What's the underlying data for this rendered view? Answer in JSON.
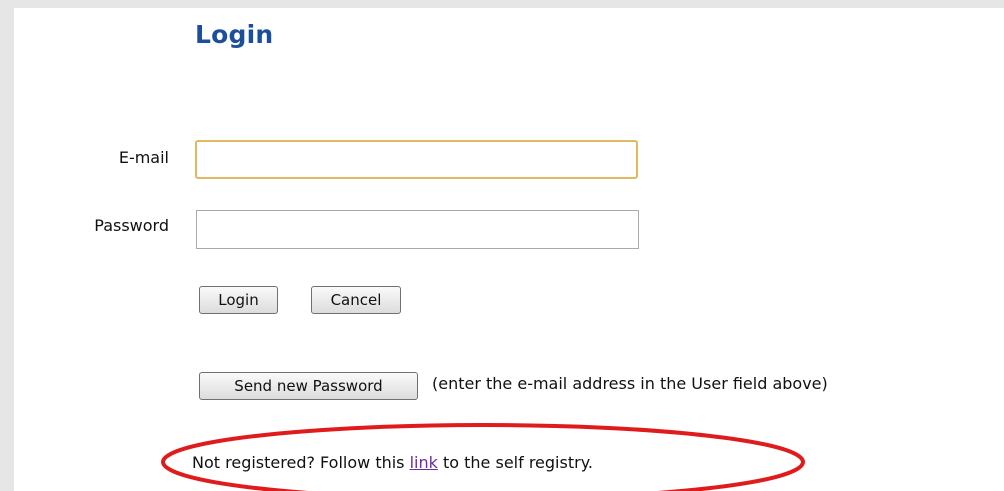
{
  "page": {
    "title": "Login"
  },
  "form": {
    "email_label": "E-mail",
    "email_value": "",
    "password_label": "Password",
    "password_value": "",
    "login_button": "Login",
    "cancel_button": "Cancel",
    "send_password_button": "Send new Password",
    "send_password_hint": "(enter the e-mail address in the User field above)"
  },
  "registry": {
    "prefix": "Not registered? Follow this ",
    "link_text": "link",
    "suffix": " to the self registry."
  },
  "annotation": {
    "highlight_color": "#e01b1b"
  }
}
